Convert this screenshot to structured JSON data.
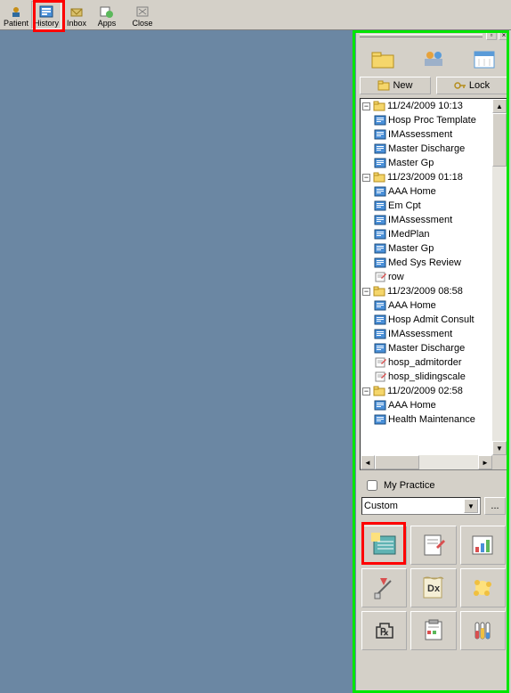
{
  "toolbar": {
    "patient_label": "Patient",
    "history_label": "History",
    "inbox_label": "Inbox",
    "apps_label": "Apps",
    "close_label": "Close"
  },
  "panel": {
    "new_label": "New",
    "lock_label": "Lock",
    "my_practice_label": "My Practice",
    "combo_value": "Custom",
    "ellipsis": "..."
  },
  "tree": [
    {
      "label": "11/24/2009 10:13",
      "expanded": true,
      "children": [
        {
          "label": "Hosp Proc Template",
          "icon": "doc"
        },
        {
          "label": "IMAssessment",
          "icon": "doc"
        },
        {
          "label": "Master Discharge",
          "icon": "doc"
        },
        {
          "label": "Master Gp",
          "icon": "doc"
        }
      ]
    },
    {
      "label": "11/23/2009 01:18",
      "expanded": true,
      "children": [
        {
          "label": "AAA Home",
          "icon": "doc"
        },
        {
          "label": "Em Cpt",
          "icon": "doc"
        },
        {
          "label": "IMAssessment",
          "icon": "doc"
        },
        {
          "label": "IMedPlan",
          "icon": "doc"
        },
        {
          "label": "Master Gp",
          "icon": "doc"
        },
        {
          "label": "Med Sys Review",
          "icon": "doc"
        },
        {
          "label": "row",
          "icon": "note"
        }
      ]
    },
    {
      "label": "11/23/2009 08:58",
      "expanded": true,
      "children": [
        {
          "label": "AAA Home",
          "icon": "doc"
        },
        {
          "label": "Hosp Admit Consult",
          "icon": "doc"
        },
        {
          "label": "IMAssessment",
          "icon": "doc"
        },
        {
          "label": "Master Discharge",
          "icon": "doc"
        },
        {
          "label": "hosp_admitorder",
          "icon": "note"
        },
        {
          "label": "hosp_slidingscale",
          "icon": "note"
        }
      ]
    },
    {
      "label": "11/20/2009 02:58",
      "expanded": true,
      "children": [
        {
          "label": "AAA Home",
          "icon": "doc"
        },
        {
          "label": "Health Maintenance",
          "icon": "doc"
        }
      ]
    }
  ]
}
